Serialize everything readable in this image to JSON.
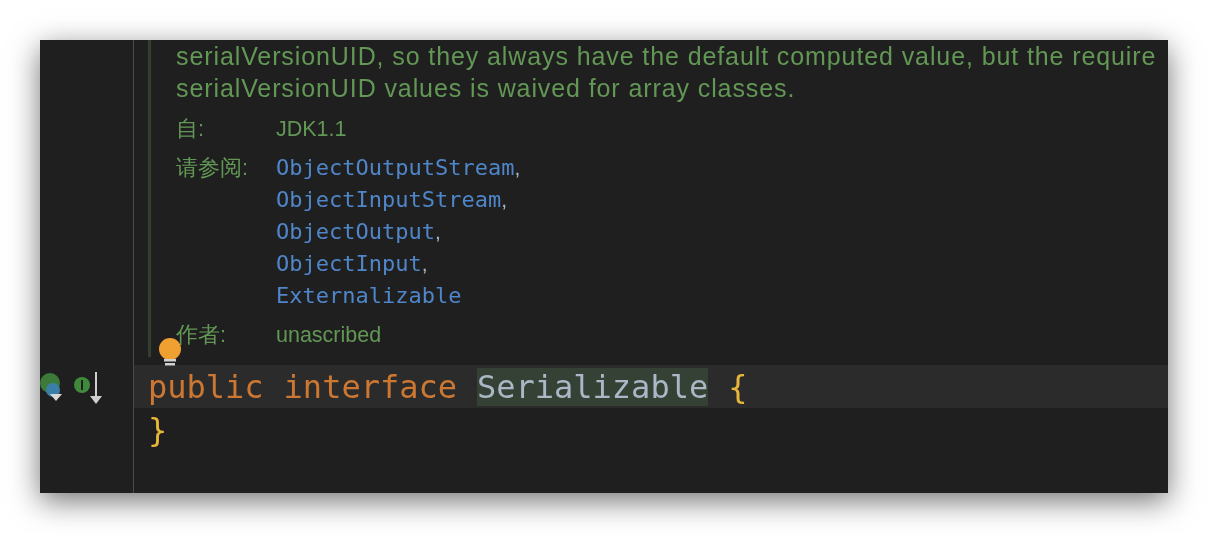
{
  "doc": {
    "lines": [
      "serialVersionUID, so they always have the default computed value, but the require",
      "serialVersionUID values is waived for array classes."
    ],
    "tags": [
      {
        "label": "自:",
        "values": [
          {
            "text": "JDK1.1",
            "kind": "text"
          }
        ]
      },
      {
        "label": "请参阅:",
        "values": [
          {
            "text": "ObjectOutputStream",
            "kind": "link",
            "suffix": ","
          },
          {
            "text": "ObjectInputStream",
            "kind": "link",
            "suffix": ","
          },
          {
            "text": "ObjectOutput",
            "kind": "link",
            "suffix": ","
          },
          {
            "text": "ObjectInput",
            "kind": "link",
            "suffix": ","
          },
          {
            "text": "Externalizable",
            "kind": "link"
          }
        ]
      },
      {
        "label": "作者:",
        "values": [
          {
            "text": "unascribed",
            "kind": "text"
          }
        ]
      }
    ]
  },
  "code_lines": [
    {
      "current": true,
      "tokens": [
        {
          "text": "public",
          "kind": "keyword"
        },
        {
          "text": "interface",
          "kind": "keyword"
        },
        {
          "text": "Serializable",
          "kind": "identifier",
          "highlighted": true
        },
        {
          "text": "{",
          "kind": "brace"
        }
      ]
    },
    {
      "current": false,
      "tokens": [
        {
          "text": "}",
          "kind": "brace"
        }
      ]
    }
  ]
}
